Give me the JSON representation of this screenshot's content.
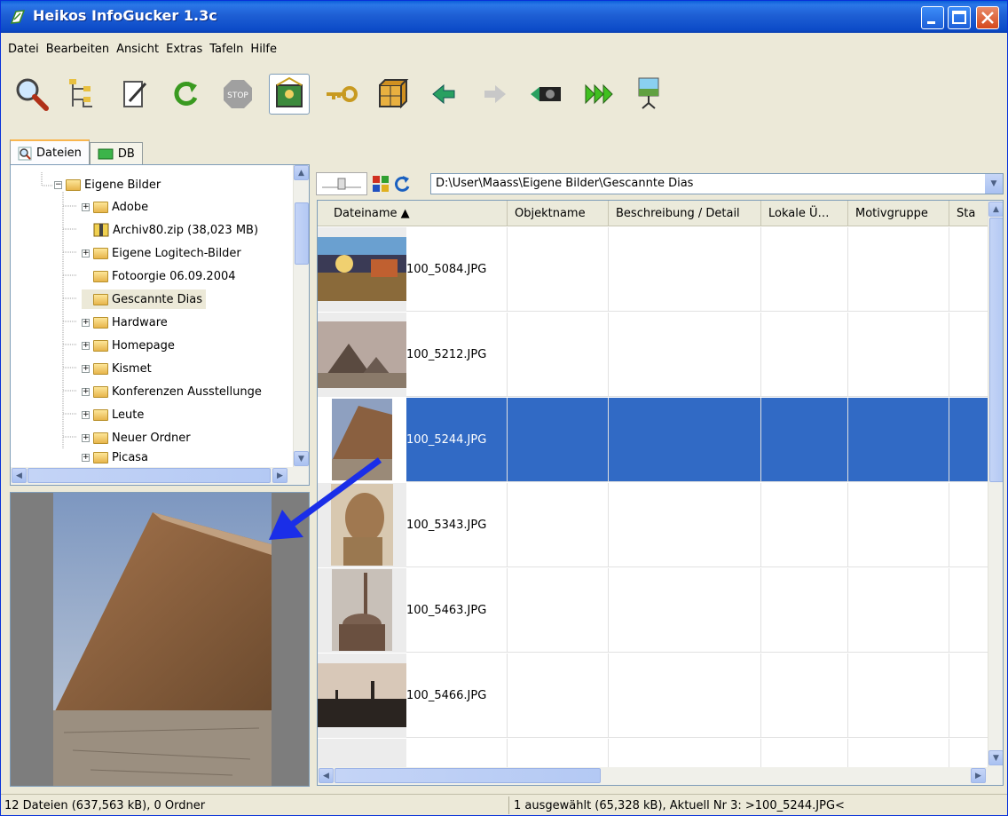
{
  "window": {
    "title": "Heikos InfoGucker 1.3c"
  },
  "menu": [
    "Datei",
    "Bearbeiten",
    "Ansicht",
    "Extras",
    "Tafeln",
    "Hilfe"
  ],
  "toolbar": {
    "icons": [
      "search-icon",
      "tree-view-icon",
      "edit-icon",
      "refresh-icon",
      "stop-icon",
      "picture-view-icon",
      "key-icon",
      "box-icon",
      "back-arrow-icon",
      "forward-arrow-icon",
      "camera-icon",
      "fast-forward-icon",
      "slideshow-icon"
    ]
  },
  "tabs": [
    {
      "label": "Dateien"
    },
    {
      "label": "DB"
    }
  ],
  "tree": {
    "items": [
      {
        "label": "Eigene Bilder",
        "expander": "−"
      },
      {
        "label": "Adobe",
        "expander": "+"
      },
      {
        "label": "Archiv80.zip (38,023 MB)",
        "expander": ""
      },
      {
        "label": "Eigene Logitech-Bilder",
        "expander": "+"
      },
      {
        "label": "Fotoorgie 06.09.2004",
        "expander": ""
      },
      {
        "label": "Gescannte Dias",
        "expander": ""
      },
      {
        "label": "Hardware",
        "expander": "+"
      },
      {
        "label": "Homepage",
        "expander": "+"
      },
      {
        "label": "Kismet",
        "expander": "+"
      },
      {
        "label": "Konferenzen Ausstellunge",
        "expander": "+"
      },
      {
        "label": "Leute",
        "expander": "+"
      },
      {
        "label": "Neuer Ordner",
        "expander": "+"
      },
      {
        "label": "Picasa",
        "expander": "+"
      }
    ]
  },
  "path": {
    "value": "D:\\User\\Maass\\Eigene Bilder\\Gescannte Dias"
  },
  "grid": {
    "columns": [
      "Dateiname ▲",
      "Objektname",
      "Beschreibung / Detail",
      "Lokale Ü…",
      "Motivgruppe",
      "Sta"
    ],
    "rows": [
      {
        "name": "100_5084.JPG"
      },
      {
        "name": "100_5212.JPG"
      },
      {
        "name": "100_5244.JPG"
      },
      {
        "name": "100_5343.JPG"
      },
      {
        "name": "100_5463.JPG"
      },
      {
        "name": "100_5466.JPG"
      },
      {
        "name": ""
      }
    ],
    "selected_index": 2
  },
  "status": {
    "left": "12 Dateien (637,563 kB), 0 Ordner",
    "right": "1 ausgewählt (65,328 kB), Aktuell Nr 3: >100_5244.JPG<"
  },
  "colors": {
    "selection": "#316ac5",
    "annotation_arrow": "#1a2ee8",
    "titlebar": "#0a5fd8"
  }
}
